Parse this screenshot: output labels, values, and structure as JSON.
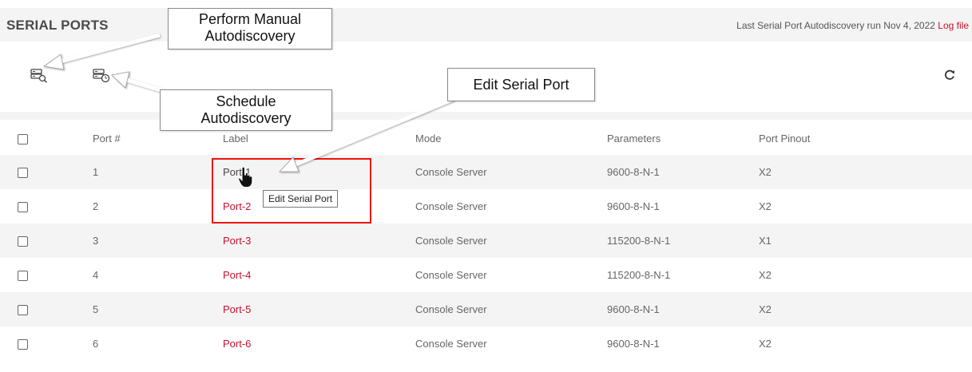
{
  "header": {
    "title": "SERIAL PORTS",
    "last_run_text": "Last Serial Port Autodiscovery run Nov 4, 2022",
    "log_link": "Log file"
  },
  "toolbar": {
    "manual_autodiscovery_icon": "server-search-icon",
    "schedule_autodiscovery_icon": "server-clock-icon",
    "refresh_icon": "refresh-icon"
  },
  "table": {
    "columns": [
      "Port #",
      "Label",
      "Mode",
      "Parameters",
      "Port Pinout"
    ],
    "rows": [
      {
        "port": "1",
        "label": "Port-1",
        "mode": "Console Server",
        "parameters": "9600-8-N-1",
        "pinout": "X2"
      },
      {
        "port": "2",
        "label": "Port-2",
        "mode": "Console Server",
        "parameters": "9600-8-N-1",
        "pinout": "X2"
      },
      {
        "port": "3",
        "label": "Port-3",
        "mode": "Console Server",
        "parameters": "115200-8-N-1",
        "pinout": "X1"
      },
      {
        "port": "4",
        "label": "Port-4",
        "mode": "Console Server",
        "parameters": "115200-8-N-1",
        "pinout": "X2"
      },
      {
        "port": "5",
        "label": "Port-5",
        "mode": "Console Server",
        "parameters": "9600-8-N-1",
        "pinout": "X2"
      },
      {
        "port": "6",
        "label": "Port-6",
        "mode": "Console Server",
        "parameters": "9600-8-N-1",
        "pinout": "X2"
      }
    ]
  },
  "tooltip": "Edit Serial Port",
  "callouts": {
    "manual": [
      "Perform Manual",
      "Autodiscovery"
    ],
    "schedule": [
      "Schedule",
      "Autodiscovery"
    ],
    "edit": "Edit Serial Port"
  },
  "colors": {
    "accent": "#c8102e",
    "highlight_box": "#ee1111",
    "row_alt": "#f4f4f4"
  }
}
